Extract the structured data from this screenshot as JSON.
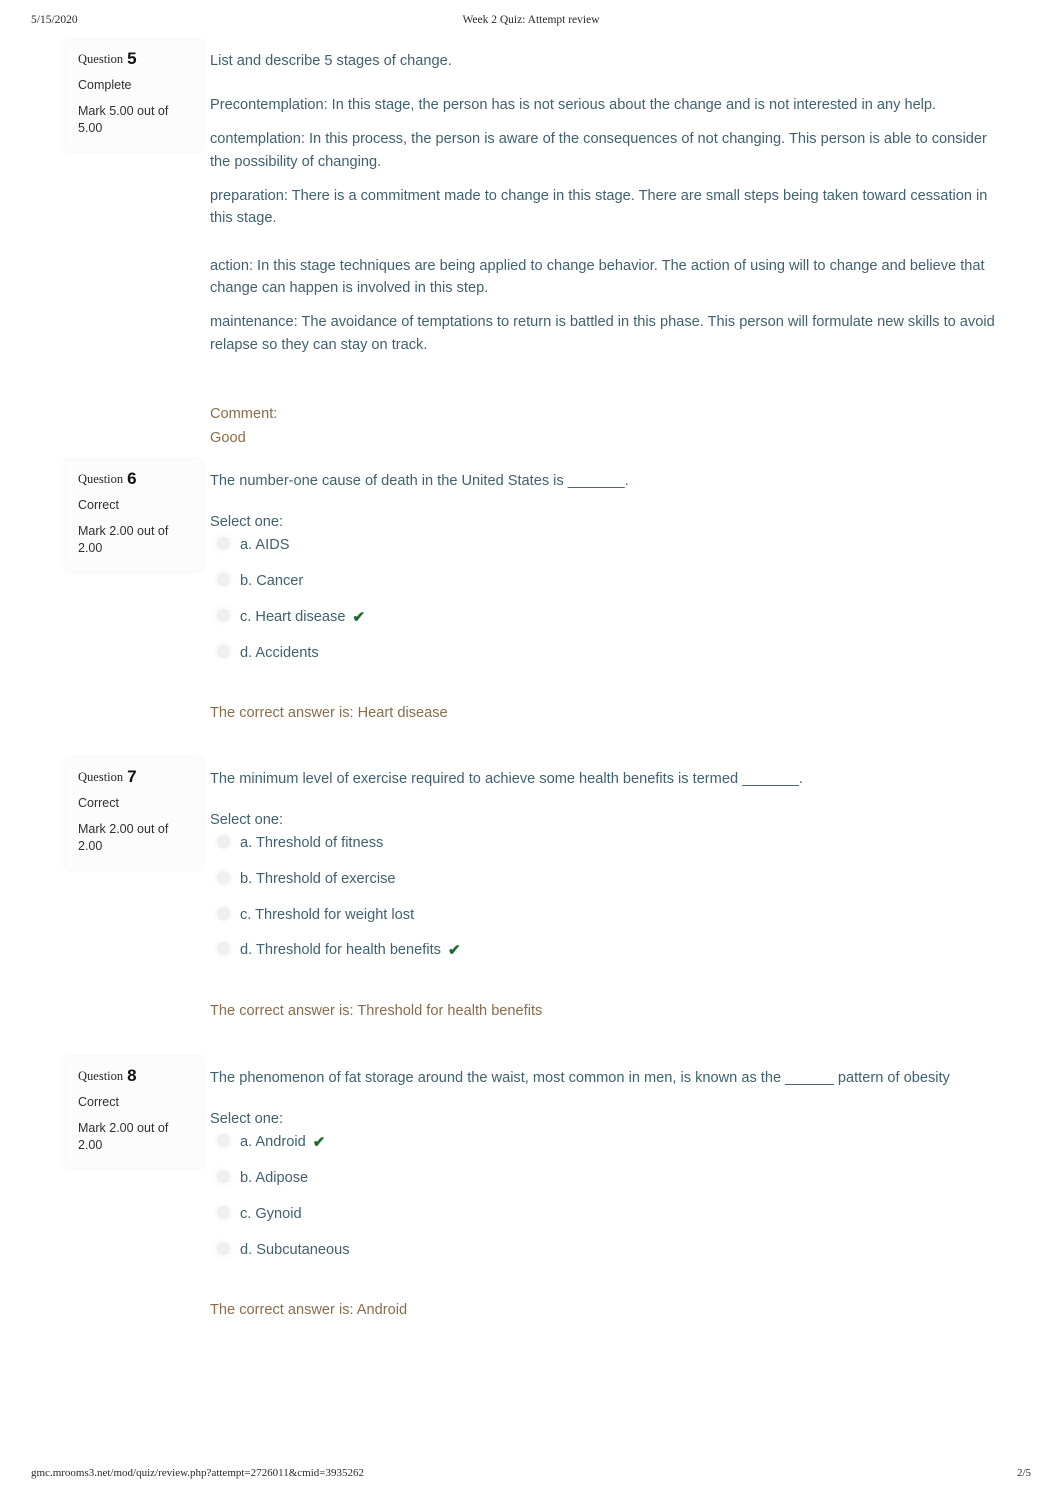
{
  "print_header": {
    "date": "5/15/2020",
    "title": "Week 2 Quiz: Attempt review"
  },
  "print_footer": {
    "url": "gmc.mrooms3.net/mod/quiz/review.php?attempt=2726011&cmid=3935262",
    "page": "2/5"
  },
  "labels": {
    "question_word": "Question",
    "select_one": "Select one:",
    "comment_label": "Comment:"
  },
  "colors": {
    "question_text": "#40616f",
    "feedback_text": "#8a6d4a",
    "correct_check": "#1e6b2f",
    "info_text": "#2f2f2f"
  },
  "questions": [
    {
      "number": "5",
      "state": "Complete",
      "mark": "Mark 5.00 out of 5.00",
      "prompt": "List and describe 5 stages of change.",
      "essay_paragraphs": [
        "Precontemplation: In this stage, the person has is not serious about the change and is not interested in any help.",
        "contemplation: In this process, the person is aware of the consequences of not changing. This person is able to consider the possibility of changing.",
        "preparation: There is a commitment made to change in this stage. There are small steps being taken toward cessation in this stage.",
        "action: In this stage techniques are being applied to change behavior. The action of using will to change and believe that change can happen is involved in this step.",
        "maintenance: The avoidance of temptations to return is battled in this phase. This person will formulate new skills to avoid relapse so they can stay on track."
      ],
      "comment": "Good"
    },
    {
      "number": "6",
      "state": "Correct",
      "mark": "Mark 2.00 out of 2.00",
      "prompt": "The number-one cause of death in the United States is _______.",
      "options": [
        {
          "label": "a. AIDS",
          "checked": false
        },
        {
          "label": "b. Cancer",
          "checked": false
        },
        {
          "label": "c. Heart disease",
          "checked": true
        },
        {
          "label": "d. Accidents",
          "checked": false
        }
      ],
      "correct_answer": "The correct answer is: Heart disease"
    },
    {
      "number": "7",
      "state": "Correct",
      "mark": "Mark 2.00 out of 2.00",
      "prompt": "The minimum level of exercise required to achieve some health benefits is termed _______.",
      "options": [
        {
          "label": "a. Threshold of fitness",
          "checked": false
        },
        {
          "label": "b. Threshold of exercise",
          "checked": false
        },
        {
          "label": "c. Threshold for weight lost",
          "checked": false
        },
        {
          "label": "d. Threshold for health benefits",
          "checked": true
        }
      ],
      "correct_answer": "The correct answer is: Threshold for health benefits"
    },
    {
      "number": "8",
      "state": "Correct",
      "mark": "Mark 2.00 out of 2.00",
      "prompt": "The phenomenon of fat storage around the waist, most common in men, is known as the ______ pattern of obesity",
      "options": [
        {
          "label": "a. Android",
          "checked": true
        },
        {
          "label": "b. Adipose",
          "checked": false
        },
        {
          "label": "c. Gynoid",
          "checked": false
        },
        {
          "label": "d. Subcutaneous",
          "checked": false
        }
      ],
      "correct_answer": "The correct answer is: Android"
    }
  ],
  "icons": {
    "correct_check": "✔"
  }
}
